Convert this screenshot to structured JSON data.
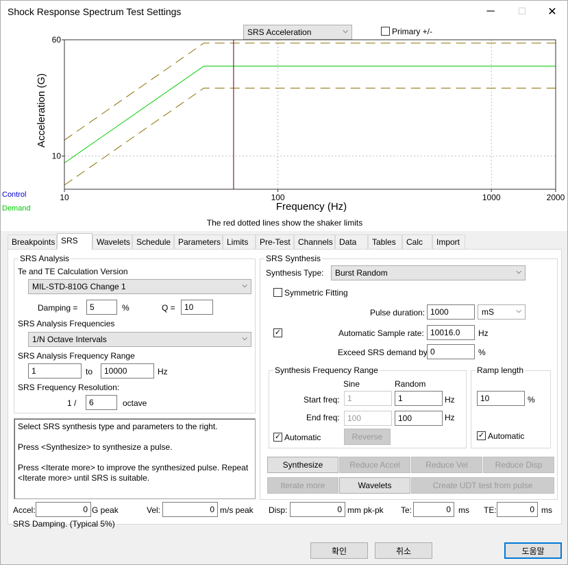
{
  "window": {
    "title": "Shock Response Spectrum Test Settings",
    "min_icon": "minimize-icon",
    "max_icon": "maximize-icon",
    "close_icon": "close-icon"
  },
  "plot_controls": {
    "view_select": "SRS Acceleration",
    "primary_label": "Primary +/-",
    "primary_checked": false
  },
  "legend": {
    "control": "Control",
    "demand": "Demand",
    "control_color": "#0000cc",
    "demand_color": "#00cc00"
  },
  "chart_data": {
    "type": "line",
    "xscale": "log",
    "yscale": "log",
    "xlim": [
      10,
      2000
    ],
    "ylim": [
      6,
      60
    ],
    "xlabel": "Frequency (Hz)",
    "ylabel": "Acceleration (G)",
    "xticks": [
      {
        "v": 10,
        "label": "10"
      },
      {
        "v": 100,
        "label": "100"
      },
      {
        "v": 1000,
        "label": "1000"
      },
      {
        "v": 2000,
        "label": "2000"
      }
    ],
    "yticks": [
      {
        "v": 10,
        "label": "10"
      },
      {
        "v": 60,
        "label": "60"
      }
    ],
    "caption": "The red dotted lines show the shaker limits",
    "series": [
      {
        "role": "demand",
        "color": "#00cc00",
        "dash": "none",
        "points": [
          [
            10,
            9.0
          ],
          [
            45,
            40
          ],
          [
            2000,
            40
          ]
        ]
      },
      {
        "role": "upper-tolerance",
        "color": "#8b7000",
        "dash": "14,8",
        "points": [
          [
            10,
            12.8
          ],
          [
            45,
            57
          ],
          [
            2000,
            57
          ]
        ]
      },
      {
        "role": "lower-tolerance",
        "color": "#8b7000",
        "dash": "14,8",
        "points": [
          [
            10,
            6.4
          ],
          [
            45,
            28.5
          ],
          [
            2000,
            28.5
          ]
        ]
      }
    ],
    "vline": {
      "x": 62,
      "color": "#7a1f5a"
    },
    "grid": {
      "x": [
        100,
        1000
      ],
      "y": [
        10
      ]
    }
  },
  "tabs": [
    "Breakpoints",
    "SRS",
    "Wavelets",
    "Schedule",
    "Parameters",
    "Limits",
    "Pre-Test",
    "Channels",
    "Data",
    "Tables",
    "Calc",
    "Import"
  ],
  "active_tab": "SRS",
  "analysis": {
    "group_title": "SRS Analysis",
    "version_label": "Te and TE Calculation Version",
    "version_value": "MIL-STD-810G Change 1",
    "damping_label": "Damping =",
    "damping_value": "5",
    "damping_unit": "%",
    "q_label": "Q =",
    "q_value": "10",
    "freqs_label": "SRS Analysis Frequencies",
    "freqs_value": "1/N Octave Intervals",
    "range_label": "SRS Analysis Frequency Range",
    "range_from": "1",
    "range_to_label": "to",
    "range_to": "10000",
    "range_unit": "Hz",
    "res_label": "SRS Frequency Resolution:",
    "res_prefix": "1 /",
    "res_value": "6",
    "res_unit": "octave"
  },
  "help_text": {
    "line1": "Select SRS synthesis type and parameters to the right.",
    "line2": "Press <Synthesize> to synthesize a pulse.",
    "line3a": "Press <Iterate more> to improve the synthesized pulse. Repeat",
    "line3b": "<Iterate more> until SRS is suitable."
  },
  "synthesis": {
    "group_title": "SRS Synthesis",
    "type_label": "Synthesis Type:",
    "type_value": "Burst Random",
    "symmetric_label": "Symmetric Fitting",
    "symmetric_checked": false,
    "pulse_label": "Pulse duration:",
    "pulse_value": "1000",
    "pulse_unit": "mS",
    "auto_rate_checked": true,
    "rate_label": "Automatic Sample rate:",
    "rate_value": "10016.0",
    "rate_unit": "Hz",
    "exceed_label": "Exceed SRS demand by",
    "exceed_value": "0",
    "exceed_unit": "%",
    "freq_range_title": "Synthesis Frequency Range",
    "sine_header": "Sine",
    "random_header": "Random",
    "start_label": "Start freq:",
    "start_sine": "1",
    "start_random": "1",
    "end_label": "End freq:",
    "end_sine": "100",
    "end_random": "100",
    "hz": "Hz",
    "auto_label": "Automatic",
    "auto_checked": true,
    "reverse_label": "Reverse",
    "ramp_title": "Ramp length",
    "ramp_value": "10",
    "ramp_unit": "%",
    "ramp_auto_label": "Automatic",
    "ramp_auto_checked": true
  },
  "actions": {
    "synthesize": "Synthesize",
    "reduce_accel": "Reduce Accel",
    "reduce_vel": "Reduce Vel",
    "reduce_disp": "Reduce Disp",
    "iterate": "Iterate more",
    "wavelets": "Wavelets",
    "create_udt": "Create UDT test from pulse"
  },
  "results": {
    "accel_label": "Accel:",
    "accel_value": "0",
    "accel_unit": "G peak",
    "vel_label": "Vel:",
    "vel_value": "0",
    "vel_unit": "m/s peak",
    "disp_label": "Disp:",
    "disp_value": "0",
    "disp_unit": "mm pk-pk",
    "te_small_label": "Te:",
    "te_small_value": "0",
    "te_small_unit": "ms",
    "te_big_label": "TE:",
    "te_big_value": "0",
    "te_big_unit": "ms"
  },
  "status_text": "SRS Damping. (Typical 5%)",
  "footer": {
    "ok": "확인",
    "cancel": "취소",
    "help": "도움말"
  }
}
